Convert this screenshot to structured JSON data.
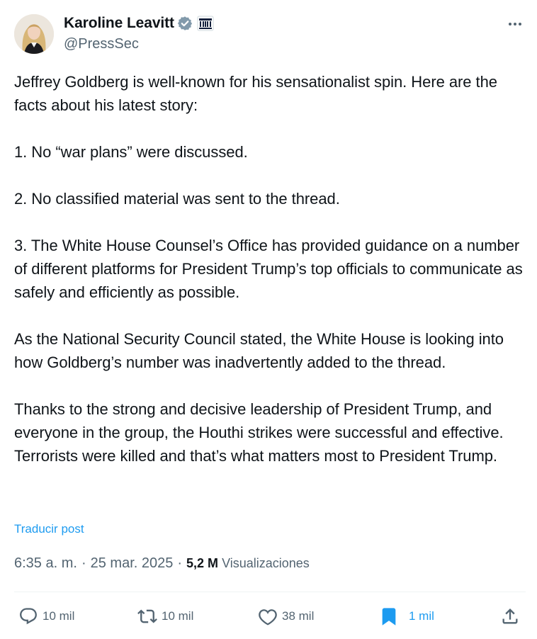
{
  "author": {
    "display_name": "Karoline Leavitt",
    "handle": "@PressSec"
  },
  "icons": {
    "verified": "verified-badge-icon",
    "affiliation": "white-house-icon",
    "more": "more-options-icon",
    "reply": "comment-icon",
    "repost": "repost-icon",
    "like": "heart-icon",
    "bookmark": "bookmark-icon",
    "share": "share-icon"
  },
  "colors": {
    "accent": "#1d9bf0",
    "verified": "#829aab",
    "muted": "#536471",
    "text": "#0f1419"
  },
  "post": {
    "text": "Jeffrey Goldberg is well-known for his sensationalist spin. Here are the facts about his latest story:\n\n1. No “war plans” were discussed.\n\n2. No classified material was sent to the thread.\n\n3. The White House Counsel’s Office has provided guidance on a number of different platforms for President Trump’s top officials to communicate as safely and efficiently as possible.\n\nAs the National Security Council stated, the White House is looking into how Goldberg’s number was inadvertently added to the thread.\n\nThanks to the strong and decisive leadership of President Trump, and everyone in the group, the Houthi strikes were successful and effective. Terrorists were killed and that’s what matters most to President Trump.",
    "translate_label": "Traducir post",
    "time": "6:35 a. m.",
    "separator": "·",
    "date": "25 mar. 2025",
    "views_count": "5,2 M",
    "views_label": "Visualizaciones"
  },
  "actions": {
    "replies": "10 mil",
    "reposts": "10 mil",
    "likes": "38 mil",
    "bookmarks": "1 mil"
  }
}
